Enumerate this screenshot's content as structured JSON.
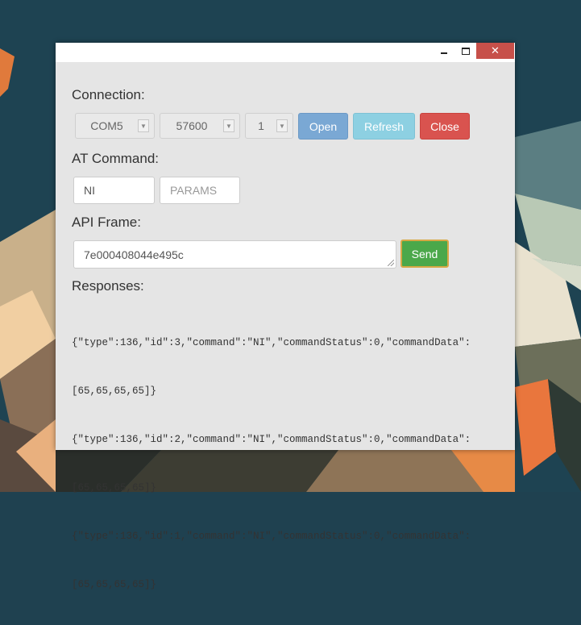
{
  "window": {
    "minimize_icon": "minimize-icon",
    "maximize_icon": "maximize-icon",
    "close_icon": "close-icon",
    "close_glyph": "✕"
  },
  "connection": {
    "label": "Connection:",
    "port": "COM5",
    "baud": "57600",
    "id": "1",
    "open_label": "Open",
    "refresh_label": "Refresh",
    "close_label": "Close"
  },
  "at_command": {
    "label": "AT Command:",
    "command_value": "NI",
    "params_placeholder": "PARAMS"
  },
  "api_frame": {
    "label": "API Frame:",
    "value": "7e000408044e495c",
    "send_label": "Send"
  },
  "responses": {
    "label": "Responses:",
    "lines": [
      "{\"type\":136,\"id\":3,\"command\":\"NI\",\"commandStatus\":0,\"commandData\":",
      "[65,65,65,65]}",
      "{\"type\":136,\"id\":2,\"command\":\"NI\",\"commandStatus\":0,\"commandData\":",
      "[65,65,65,65]}",
      "{\"type\":136,\"id\":1,\"command\":\"NI\",\"commandStatus\":0,\"commandData\":",
      "[65,65,65,65]}"
    ]
  },
  "colors": {
    "open": "#7aa8d4",
    "refresh": "#8dd0e2",
    "close": "#d9534f",
    "send": "#4ba84a",
    "window_bg": "#e5e5e5"
  }
}
